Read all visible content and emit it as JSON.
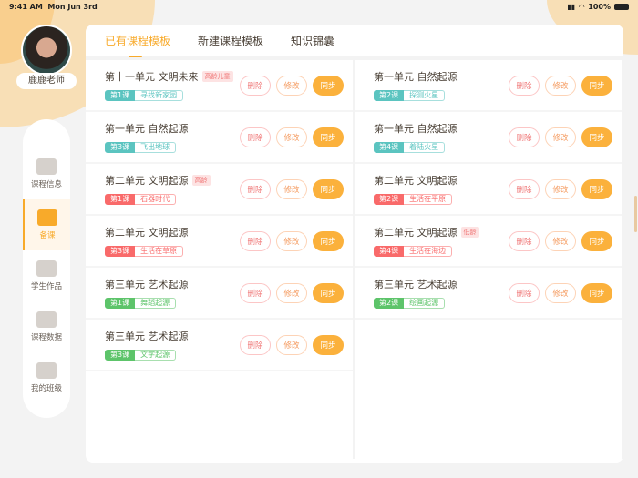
{
  "status": {
    "time": "9:41 AM",
    "date": "Mon Jun 3rd",
    "battery": "100%"
  },
  "user": {
    "name": "鹿鹿老师"
  },
  "sidebar": [
    {
      "label": "课程信息",
      "icon": "calendar-icon"
    },
    {
      "label": "备课",
      "icon": "book-pencil-icon",
      "active": true
    },
    {
      "label": "学生作品",
      "icon": "image-icon"
    },
    {
      "label": "课程数据",
      "icon": "chart-icon"
    },
    {
      "label": "我的班级",
      "icon": "person-icon"
    }
  ],
  "tabs": [
    {
      "label": "已有课程模板",
      "active": true
    },
    {
      "label": "新建课程模板"
    },
    {
      "label": "知识锦囊"
    }
  ],
  "buttons": {
    "delete": "删除",
    "edit": "修改",
    "sync": "同步"
  },
  "colors": {
    "teal": "#5bc4c0",
    "red": "#f96a6a",
    "green": "#5dc46a",
    "accent": "#f8aa2a"
  },
  "left": [
    {
      "unit": "第十一单元 文明未来",
      "badge": "高龄儿童",
      "lesson": "第1课",
      "name": "寻找新家园",
      "color": "teal"
    },
    {
      "unit": "第一单元 自然起源",
      "lesson": "第3课",
      "name": "飞出地球",
      "color": "teal"
    },
    {
      "unit": "第二单元 文明起源",
      "badge": "高龄",
      "lesson": "第1课",
      "name": "石器时代",
      "color": "red"
    },
    {
      "unit": "第二单元 文明起源",
      "lesson": "第3课",
      "name": "生活在草原",
      "color": "red"
    },
    {
      "unit": "第三单元 艺术起源",
      "lesson": "第1课",
      "name": "舞蹈起源",
      "color": "green"
    },
    {
      "unit": "第三单元 艺术起源",
      "lesson": "第3课",
      "name": "文字起源",
      "color": "green"
    }
  ],
  "right": [
    {
      "unit": "第一单元 自然起源",
      "lesson": "第2课",
      "name": "探测火星",
      "color": "teal"
    },
    {
      "unit": "第一单元 自然起源",
      "lesson": "第4课",
      "name": "着陆火星",
      "color": "teal"
    },
    {
      "unit": "第二单元 文明起源",
      "lesson": "第2课",
      "name": "生活在平原",
      "color": "red"
    },
    {
      "unit": "第二单元 文明起源",
      "badge": "低龄",
      "lesson": "第4课",
      "name": "生活在海边",
      "color": "red"
    },
    {
      "unit": "第三单元 艺术起源",
      "lesson": "第2课",
      "name": "绘画起源",
      "color": "green"
    }
  ]
}
